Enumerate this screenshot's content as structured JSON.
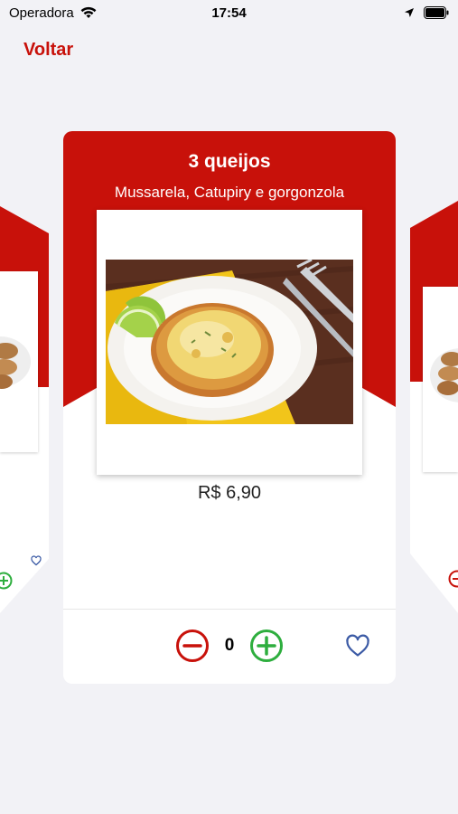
{
  "status_bar": {
    "carrier": "Operadora",
    "time": "17:54"
  },
  "nav": {
    "back_label": "Voltar"
  },
  "product": {
    "title": "3 queijos",
    "description": "Mussarela, Catupiry e gorgonzola",
    "price": "R$ 6,90",
    "quantity": "0"
  },
  "icons": {
    "minus": "minus-circle-icon",
    "plus": "plus-circle-icon",
    "favorite": "heart-icon"
  },
  "colors": {
    "brand_red": "#c8110a",
    "minus_red": "#c8110a",
    "plus_green": "#2eae3e",
    "heart_blue": "#3b5aa5",
    "background": "#f2f2f6"
  }
}
